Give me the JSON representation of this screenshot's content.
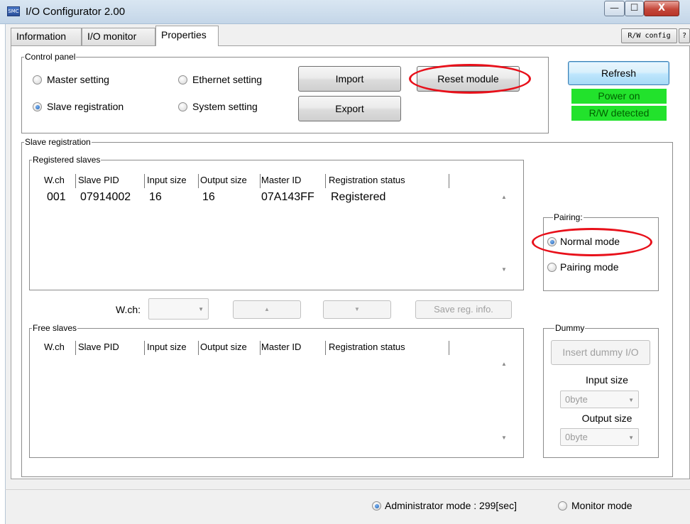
{
  "window": {
    "title": "I/O Configurator 2.00",
    "app_icon_text": "SMC",
    "minimize": "—",
    "maximize": "☐",
    "close": "X"
  },
  "tabs": [
    {
      "label": "Information"
    },
    {
      "label": "I/O monitor"
    },
    {
      "label": "Properties"
    }
  ],
  "toolbar": {
    "rw_config": "R/W config",
    "help": "?"
  },
  "control_panel": {
    "legend": "Control panel",
    "radios": [
      {
        "label": "Master setting",
        "selected": false
      },
      {
        "label": "Ethernet setting",
        "selected": false
      },
      {
        "label": "Slave registration",
        "selected": true
      },
      {
        "label": "System setting",
        "selected": false
      }
    ],
    "import_label": "Import",
    "export_label": "Export",
    "reset_label": "Reset module"
  },
  "refresh_label": "Refresh",
  "status": {
    "power": "Power on",
    "rw": "R/W detected",
    "color": "#22e22c"
  },
  "slave_registration": {
    "legend": "Slave registration",
    "registered": {
      "legend": "Registered slaves",
      "columns": [
        "W.ch",
        "Slave PID",
        "Input size",
        "Output size",
        "Master ID",
        "Registration status"
      ],
      "rows": [
        [
          "001",
          "07914002",
          "16",
          "16",
          "07A143FF",
          "Registered"
        ]
      ]
    },
    "wch_label": "W.ch:",
    "up_arrow": "▲",
    "down_arrow": "▼",
    "save_label": "Save reg. info.",
    "free": {
      "legend": "Free slaves",
      "columns": [
        "W.ch",
        "Slave PID",
        "Input size",
        "Output size",
        "Master ID",
        "Registration status"
      ]
    }
  },
  "pairing": {
    "legend": "Pairing:",
    "normal": "Normal mode",
    "pairing": "Pairing mode",
    "selected": "normal"
  },
  "dummy": {
    "legend": "Dummy",
    "insert_label": "Insert dummy I/O",
    "input_size_label": "Input size",
    "input_size_value": "0byte",
    "output_size_label": "Output size",
    "output_size_value": "0byte"
  },
  "bottom": {
    "admin_label": "Administrator mode : 299[sec]",
    "monitor_label": "Monitor mode",
    "mode": "admin"
  },
  "highlight_color": "#e8101a"
}
